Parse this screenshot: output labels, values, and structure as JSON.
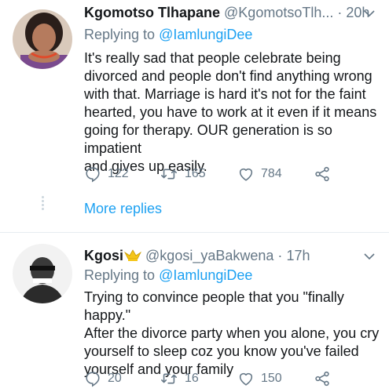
{
  "tweets": [
    {
      "name": "Kgomotso Tlhapane",
      "handle": "@KgomotsoTlh...",
      "separator": "·",
      "time": "20h",
      "reply_prefix": "Replying to",
      "reply_to": "@IamlungiDee",
      "lines": [
        "It's really sad that people celebrate being",
        "divorced and people don't find anything wrong",
        "with that. Marriage is hard it's not for the faint",
        "hearted, you have to work at it even if it means",
        "going for therapy. OUR generation is so impatient",
        "and gives up easily."
      ],
      "replies": "122",
      "retweets": "165",
      "likes": "784"
    },
    {
      "name": "Kgosi",
      "handle": "@kgosi_yaBakwena",
      "separator": "·",
      "time": "17h",
      "reply_prefix": "Replying to",
      "reply_to": "@IamlungiDee",
      "lines": [
        "Trying to convince people that you \"finally happy.\"",
        "After the divorce party when you alone, you cry",
        "yourself to sleep coz you know you've failed",
        "yourself and your family"
      ],
      "replies": "20",
      "retweets": "16",
      "likes": "150"
    }
  ],
  "more_replies": "More replies",
  "icons": {
    "reply": "reply-icon",
    "retweet": "retweet-icon",
    "like": "heart-icon",
    "share": "share-icon",
    "menu": "chevron-down-icon",
    "crown": "crown-emoji-icon"
  },
  "colors": {
    "text": "#14171a",
    "secondary": "#657786",
    "link": "#1da1f2",
    "divider": "#e6ecf0"
  }
}
